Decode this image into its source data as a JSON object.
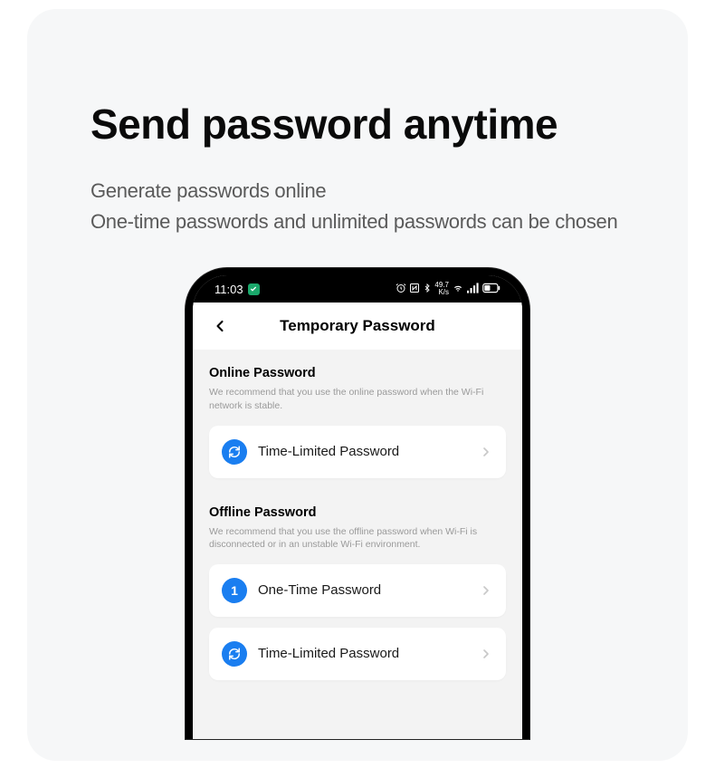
{
  "heading": "Send password anytime",
  "subheading_line1": "Generate passwords online",
  "subheading_line2": "One-time passwords and unlimited passwords can be chosen",
  "status": {
    "time": "11:03",
    "net_rate": "49.7",
    "net_unit": "K/s"
  },
  "app": {
    "title": "Temporary Password"
  },
  "sections": [
    {
      "title": "Online Password",
      "desc": "We recommend that you use the online password when the Wi-Fi network is stable.",
      "options": [
        {
          "icon": "sync",
          "label": "Time-Limited Password"
        }
      ]
    },
    {
      "title": "Offline Password",
      "desc": "We recommend that you use the offline password when Wi-Fi is disconnected or in an unstable Wi-Fi environment.",
      "options": [
        {
          "icon": "num",
          "num": "1",
          "label": "One-Time Password"
        },
        {
          "icon": "sync",
          "label": "Time-Limited Password"
        }
      ]
    }
  ]
}
